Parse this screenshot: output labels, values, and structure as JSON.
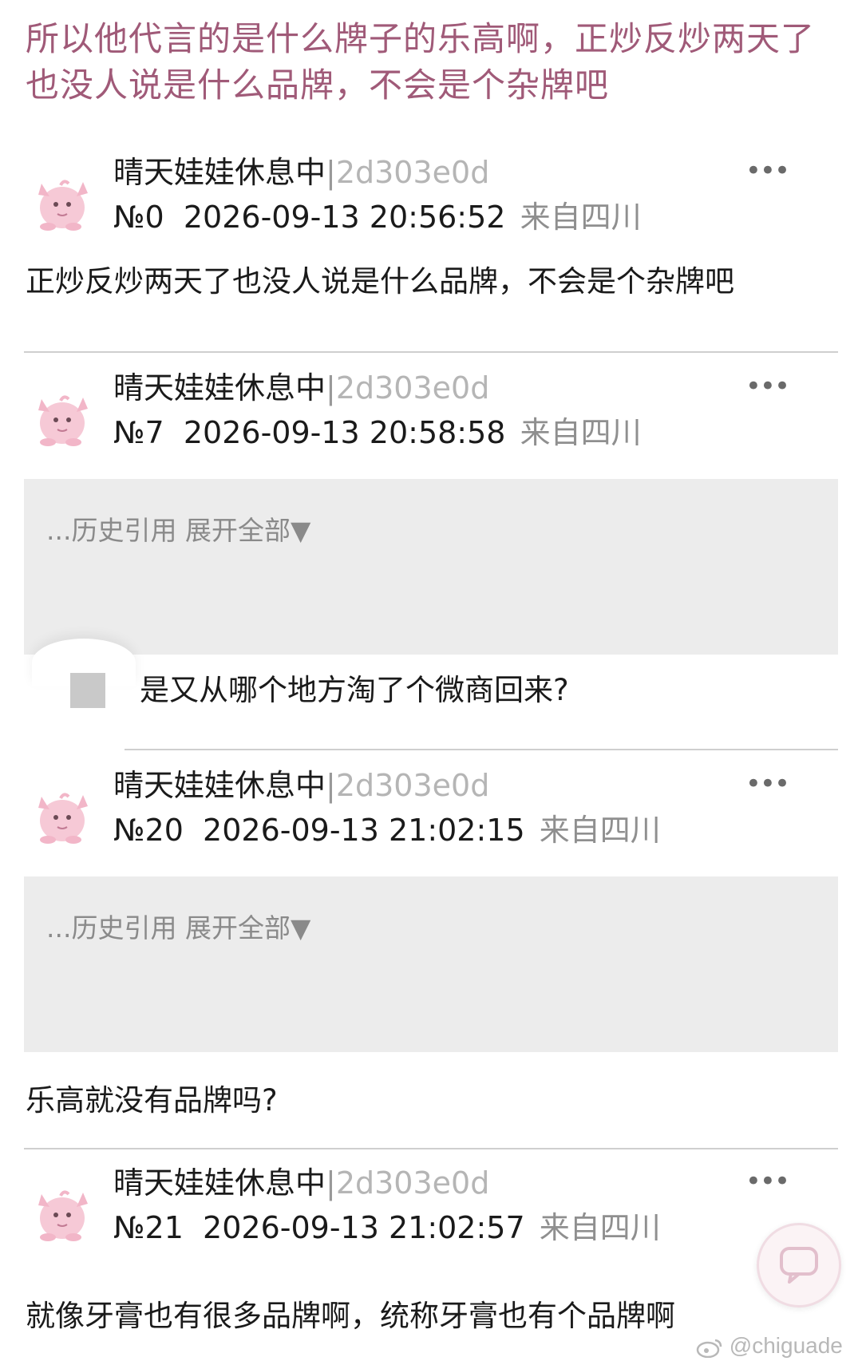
{
  "thread": {
    "title": "所以他代言的是什么牌子的乐高啊，正炒反炒两天了也没人说是什么品牌，不会是个杂牌吧"
  },
  "posts": [
    {
      "username": "晴天娃娃休息中",
      "uid": "2d303e0d",
      "number": "№0",
      "datetime": "2026-09-13 20:56:52",
      "location": "来自四川",
      "more_label": "•••",
      "content": "正炒反炒两天了也没人说是什么品牌，不会是个杂牌吧"
    },
    {
      "username": "晴天娃娃休息中",
      "uid": "2d303e0d",
      "number": "№7",
      "datetime": "2026-09-13 20:58:58",
      "location": "来自四川",
      "more_label": "•••",
      "quote_label": "...历史引用 展开全部▼",
      "content": "是又从哪个地方淘了个微商回来?"
    },
    {
      "username": "晴天娃娃休息中",
      "uid": "2d303e0d",
      "number": "№20",
      "datetime": "2026-09-13 21:02:15",
      "location": "来自四川",
      "more_label": "•••",
      "quote_label": "...历史引用 展开全部▼",
      "content": "乐高就没有品牌吗?"
    },
    {
      "username": "晴天娃娃休息中",
      "uid": "2d303e0d",
      "number": "№21",
      "datetime": "2026-09-13 21:02:57",
      "location": "来自四川",
      "more_label": "•••",
      "content": "就像牙膏也有很多品牌啊，统称牙膏也有个品牌啊"
    }
  ],
  "watermark": "@chiguade",
  "colors": {
    "title": "#a05a78",
    "uid": "#b5b5b5",
    "location": "#8f8f8f",
    "quote_bg": "#ececec",
    "avatar_pink": "#f6c9d6"
  },
  "icons": {
    "avatar": "clefairy-avatar-icon",
    "more": "more-dots-icon",
    "fab": "comment-icon"
  }
}
